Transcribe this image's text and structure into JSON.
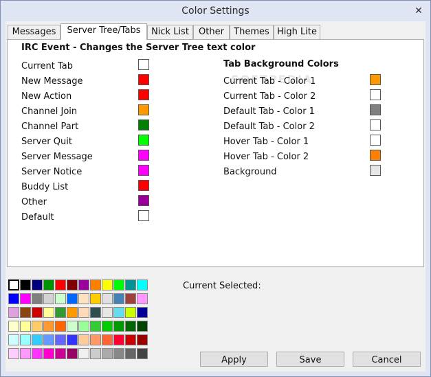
{
  "window": {
    "title": "Color Settings",
    "close_glyph": "✕"
  },
  "tabs": [
    {
      "label": "Messages",
      "active": false
    },
    {
      "label": "Server Tree/Tabs",
      "active": true
    },
    {
      "label": "Nick List",
      "active": false
    },
    {
      "label": "Other",
      "active": false
    },
    {
      "label": "Themes",
      "active": false
    },
    {
      "label": "High Lite",
      "active": false
    }
  ],
  "panel": {
    "left_heading": "IRC Event - Changes the Server Tree text color",
    "right_heading": "Tab Background Colors",
    "watermark": "SOFTPEDIA",
    "events": [
      {
        "label": "Current Tab",
        "color": "#ffffff"
      },
      {
        "label": "New Message",
        "color": "#ff0000"
      },
      {
        "label": "New Action",
        "color": "#ff0000"
      },
      {
        "label": "Channel Join",
        "color": "#ff9900"
      },
      {
        "label": "Channel Part",
        "color": "#008000"
      },
      {
        "label": "Server Quit",
        "color": "#00ff00"
      },
      {
        "label": "Server Message",
        "color": "#ff00ff"
      },
      {
        "label": "Server Notice",
        "color": "#ff00ff"
      },
      {
        "label": "Buddy List",
        "color": "#ff0000"
      },
      {
        "label": "Other",
        "color": "#990099"
      },
      {
        "label": "Default",
        "color": "#ffffff"
      }
    ],
    "tab_colors": [
      {
        "label": "Current Tab - Color 1",
        "color": "#ff9900"
      },
      {
        "label": "Current Tab - Color 2",
        "color": "#ffffff"
      },
      {
        "label": "Default Tab - Color 1",
        "color": "#808080"
      },
      {
        "label": "Default Tab - Color 2",
        "color": "#ffffff"
      },
      {
        "label": "Hover Tab - Color 1",
        "color": "#ffffff"
      },
      {
        "label": "Hover Tab - Color 2",
        "color": "#ff8000"
      },
      {
        "label": "Background",
        "color": "#e6e6e6"
      }
    ]
  },
  "palette": {
    "rows": [
      [
        "#ffffff",
        "#000000",
        "#00007f",
        "#009300",
        "#ff0000",
        "#7f0000",
        "#9c009c",
        "#fc7f00",
        "#ffff00",
        "#00fc00",
        "#009393",
        "#00ffff"
      ],
      [
        "#0000fc",
        "#ff00ff",
        "#7f7f7f",
        "#d2d2d2",
        "#ccffcc",
        "#0066ff",
        "#ffe0c0",
        "#ffcc00",
        "#e0e0e0",
        "#4682b4",
        "#a0403c",
        "#ff99ff"
      ],
      [
        "#e0a0e0",
        "#8b4513",
        "#cc0000",
        "#ffff99",
        "#339933",
        "#ff9900",
        "#ffdab9",
        "#2f4f4f",
        "#e6e6e6",
        "#66ddee",
        "#ccff00",
        "#000099"
      ],
      [
        "#ffffcc",
        "#ffff99",
        "#ffcc66",
        "#ff9933",
        "#ff6600",
        "#ccffcc",
        "#99ff99",
        "#33cc33",
        "#00cc00",
        "#009900",
        "#006600",
        "#004400"
      ],
      [
        "#ccffff",
        "#99ffff",
        "#33ccff",
        "#6699ff",
        "#6666ff",
        "#3333ff",
        "#ffcc99",
        "#ff9966",
        "#ff6633",
        "#ff0033",
        "#cc0000",
        "#990000"
      ],
      [
        "#ffccff",
        "#ff99ff",
        "#ff33ff",
        "#ff00cc",
        "#cc0099",
        "#990066",
        "#f0f0f0",
        "#cccccc",
        "#aaaaaa",
        "#888888",
        "#666666",
        "#444444"
      ]
    ],
    "selected": "#ffffff"
  },
  "current_selected_label": "Current Selected:",
  "buttons": {
    "apply": "Apply",
    "save": "Save",
    "cancel": "Cancel"
  }
}
